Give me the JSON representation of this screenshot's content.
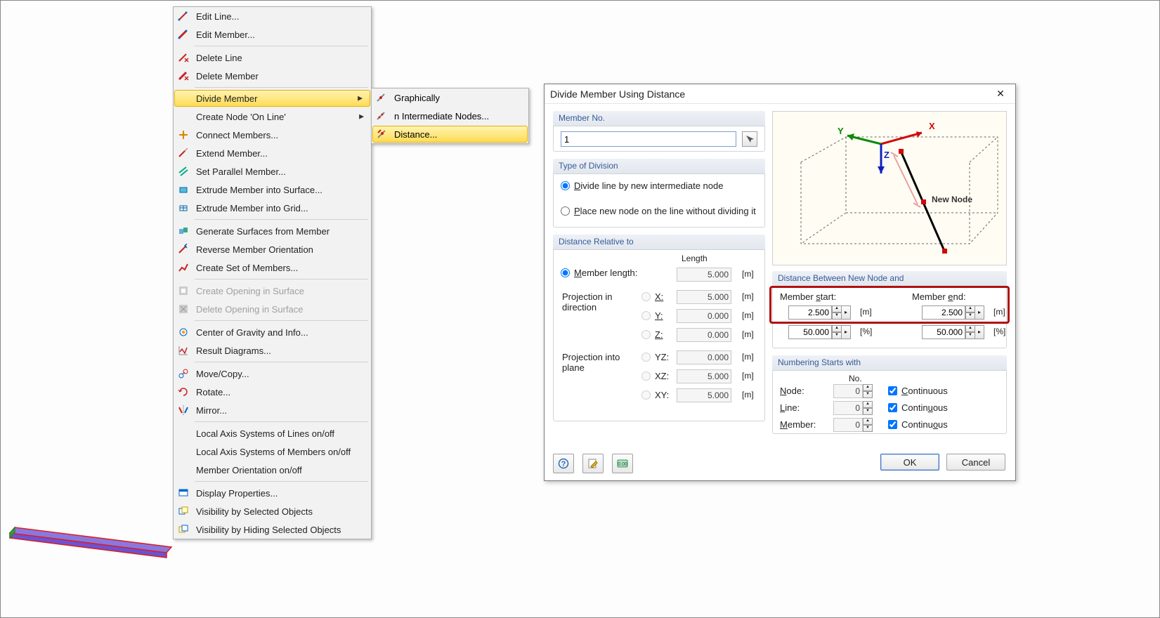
{
  "ctx": {
    "edit_line": "Edit Line...",
    "edit_member": "Edit Member...",
    "delete_line": "Delete Line",
    "delete_member": "Delete Member",
    "divide_member": "Divide Member",
    "create_node_on_line": "Create Node 'On Line'",
    "connect_members": "Connect Members...",
    "extend_member": "Extend Member...",
    "set_parallel_member": "Set Parallel Member...",
    "extrude_surface": "Extrude Member into Surface...",
    "extrude_grid": "Extrude Member into Grid...",
    "generate_surfaces": "Generate Surfaces from Member",
    "reverse_orientation": "Reverse Member Orientation",
    "create_set": "Create Set of Members...",
    "create_opening": "Create Opening in Surface",
    "delete_opening": "Delete Opening in Surface",
    "center_gravity": "Center of Gravity and Info...",
    "result_diagrams": "Result Diagrams...",
    "move_copy": "Move/Copy...",
    "rotate": "Rotate...",
    "mirror": "Mirror...",
    "local_axis_lines": "Local Axis Systems of Lines on/off",
    "local_axis_members": "Local Axis Systems of Members on/off",
    "member_orientation": "Member Orientation on/off",
    "display_properties": "Display Properties...",
    "vis_selected": "Visibility by Selected Objects",
    "vis_hiding": "Visibility by Hiding Selected Objects"
  },
  "submenu": {
    "graphically": "Graphically",
    "intermediate": "n Intermediate Nodes...",
    "distance": "Distance..."
  },
  "dialog": {
    "title": "Divide Member Using Distance",
    "member_no_title": "Member No.",
    "member_no_val": "1",
    "type_title": "Type of Division",
    "type_opt1": "Divide line by new intermediate node",
    "type_opt2": "Place new node on the line without dividing it",
    "rel_title": "Distance Relative to",
    "length_hdr": "Length",
    "member_length_label": "Member length:",
    "member_length_val": "5.000",
    "proj_dir_label": "Projection in direction",
    "proj_plane_label": "Projection into plane",
    "x_lbl": "X:",
    "y_lbl": "Y:",
    "z_lbl": "Z:",
    "yz_lbl": "YZ:",
    "xz_lbl": "XZ:",
    "xy_lbl": "XY:",
    "val_x": "5.000",
    "val_y": "0.000",
    "val_z": "0.000",
    "val_yz": "0.000",
    "val_xz": "5.000",
    "val_xy": "5.000",
    "m_unit": "[m]",
    "pct_unit": "[%]",
    "preview_new_node": "New Node",
    "preview_x": "X",
    "preview_y": "Y",
    "preview_z": "Z",
    "dist_title": "Distance Between New Node and",
    "member_start": "Member start:",
    "member_end": "Member end:",
    "start_m": "2.500",
    "end_m": "2.500",
    "start_pct": "50.000",
    "end_pct": "50.000",
    "numbering_title": "Numbering Starts with",
    "no_hdr": "No.",
    "node_lbl": "Node:",
    "line_lbl": "Line:",
    "member_lbl": "Member:",
    "node_no": "0",
    "line_no": "0",
    "member_no2": "0",
    "continuous": "Continuous",
    "ok": "OK",
    "cancel": "Cancel"
  }
}
